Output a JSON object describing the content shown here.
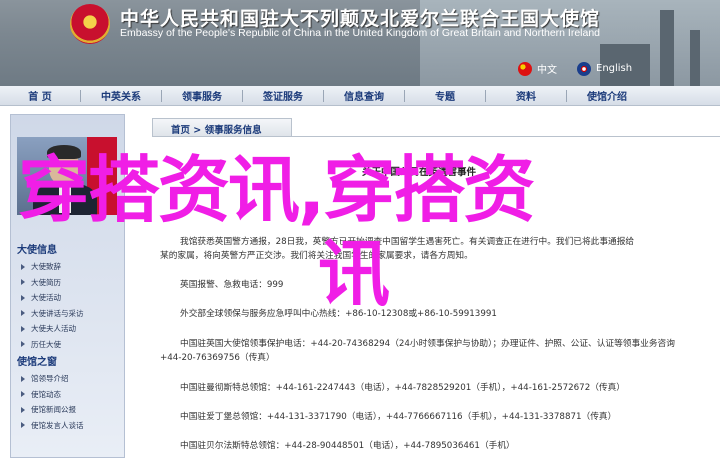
{
  "header": {
    "title_cn": "中华人民共和国驻大不列颠及北爱尔兰联合王国大使馆",
    "title_en": "Embassy of the People's Republic of China in the United Kingdom of Great Britain and Northern Ireland",
    "lang_cn": "中文",
    "lang_en": "English"
  },
  "nav": {
    "items": [
      "首 页",
      "中英关系",
      "领事服务",
      "签证服务",
      "信息查询",
      "专题",
      "资料",
      "使馆介绍"
    ]
  },
  "sidebar": {
    "ambassador_title": "大使信息",
    "ambassador_items": [
      "大使致辞",
      "大使简历",
      "大使活动",
      "大使讲话与采访",
      "大使夫人活动",
      "历任大使"
    ],
    "embassy_title": "使馆之窗",
    "embassy_items": [
      "馆领导介绍",
      "使馆动态",
      "使馆新闻公报",
      "使馆发言人谈话"
    ]
  },
  "breadcrumb": "首页 > 领事服务信息",
  "article": {
    "title": "关于中国公民在英遇害事件",
    "para1_line1": "我馆获悉英国警方通报，28日我，英警方已开始调查中国留学生遇害死亡。有关调查正在进行中。我们已将此事通报给",
    "para1_line2": "某的家属，将向英警方严正交涉。我们将关注我国学生的家属要求，请各方周知。",
    "hotline_label": "英国报警、急救电话：999",
    "ministry_line": "外交部全球领保与服务应急呼叫中心热线：+86-10-12308或+86-10-59913991",
    "embassy_line1": "中国驻英国大使馆领事保护电话：+44-20-74368294（24小时领事保护与协助）；办理证件、护照、公证、认证等领事业务咨询",
    "embassy_line2": "+44-20-76369756（传真）",
    "manchester_line": "中国驻曼彻斯特总领馆：+44-161-2247443（电话），+44-7828529201（手机），+44-161-2572672（传真）",
    "edinburgh_line": "中国驻爱丁堡总领馆：+44-131-3371790（电话），+44-7766667116（手机），+44-131-3378871（传真）",
    "belfast_line": "中国驻贝尔法斯特总领馆：+44-28-90448501（电话），+44-7895036461（手机）"
  },
  "overlay": {
    "line1": "穿搭资讯,穿搭资",
    "line2": "讯"
  },
  "colors": {
    "banner": "#7c8790",
    "nav_text": "#1b3a7a",
    "overlay": "#f01ee6",
    "sidebar": "#cfd8e8"
  }
}
